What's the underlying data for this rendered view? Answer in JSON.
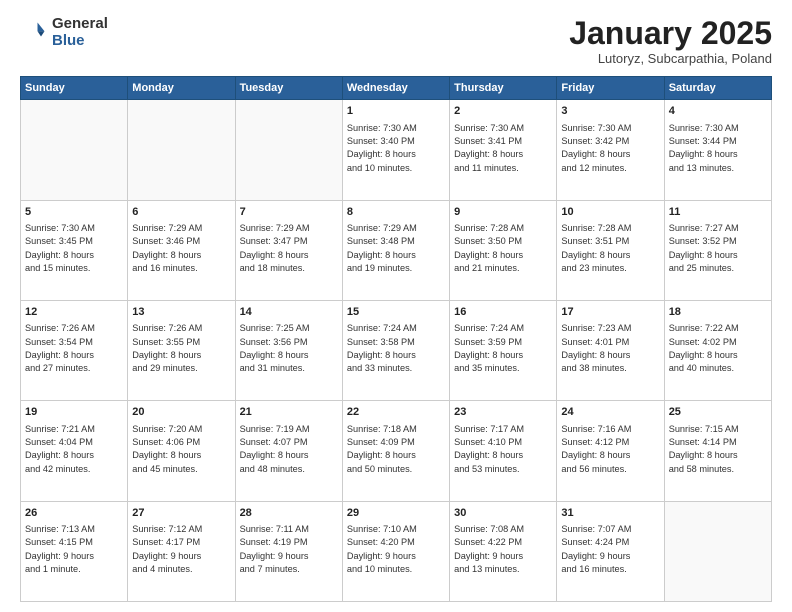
{
  "header": {
    "logo_general": "General",
    "logo_blue": "Blue",
    "month": "January 2025",
    "location": "Lutoryz, Subcarpathia, Poland"
  },
  "weekdays": [
    "Sunday",
    "Monday",
    "Tuesday",
    "Wednesday",
    "Thursday",
    "Friday",
    "Saturday"
  ],
  "weeks": [
    [
      {
        "day": "",
        "info": ""
      },
      {
        "day": "",
        "info": ""
      },
      {
        "day": "",
        "info": ""
      },
      {
        "day": "1",
        "info": "Sunrise: 7:30 AM\nSunset: 3:40 PM\nDaylight: 8 hours\nand 10 minutes."
      },
      {
        "day": "2",
        "info": "Sunrise: 7:30 AM\nSunset: 3:41 PM\nDaylight: 8 hours\nand 11 minutes."
      },
      {
        "day": "3",
        "info": "Sunrise: 7:30 AM\nSunset: 3:42 PM\nDaylight: 8 hours\nand 12 minutes."
      },
      {
        "day": "4",
        "info": "Sunrise: 7:30 AM\nSunset: 3:44 PM\nDaylight: 8 hours\nand 13 minutes."
      }
    ],
    [
      {
        "day": "5",
        "info": "Sunrise: 7:30 AM\nSunset: 3:45 PM\nDaylight: 8 hours\nand 15 minutes."
      },
      {
        "day": "6",
        "info": "Sunrise: 7:29 AM\nSunset: 3:46 PM\nDaylight: 8 hours\nand 16 minutes."
      },
      {
        "day": "7",
        "info": "Sunrise: 7:29 AM\nSunset: 3:47 PM\nDaylight: 8 hours\nand 18 minutes."
      },
      {
        "day": "8",
        "info": "Sunrise: 7:29 AM\nSunset: 3:48 PM\nDaylight: 8 hours\nand 19 minutes."
      },
      {
        "day": "9",
        "info": "Sunrise: 7:28 AM\nSunset: 3:50 PM\nDaylight: 8 hours\nand 21 minutes."
      },
      {
        "day": "10",
        "info": "Sunrise: 7:28 AM\nSunset: 3:51 PM\nDaylight: 8 hours\nand 23 minutes."
      },
      {
        "day": "11",
        "info": "Sunrise: 7:27 AM\nSunset: 3:52 PM\nDaylight: 8 hours\nand 25 minutes."
      }
    ],
    [
      {
        "day": "12",
        "info": "Sunrise: 7:26 AM\nSunset: 3:54 PM\nDaylight: 8 hours\nand 27 minutes."
      },
      {
        "day": "13",
        "info": "Sunrise: 7:26 AM\nSunset: 3:55 PM\nDaylight: 8 hours\nand 29 minutes."
      },
      {
        "day": "14",
        "info": "Sunrise: 7:25 AM\nSunset: 3:56 PM\nDaylight: 8 hours\nand 31 minutes."
      },
      {
        "day": "15",
        "info": "Sunrise: 7:24 AM\nSunset: 3:58 PM\nDaylight: 8 hours\nand 33 minutes."
      },
      {
        "day": "16",
        "info": "Sunrise: 7:24 AM\nSunset: 3:59 PM\nDaylight: 8 hours\nand 35 minutes."
      },
      {
        "day": "17",
        "info": "Sunrise: 7:23 AM\nSunset: 4:01 PM\nDaylight: 8 hours\nand 38 minutes."
      },
      {
        "day": "18",
        "info": "Sunrise: 7:22 AM\nSunset: 4:02 PM\nDaylight: 8 hours\nand 40 minutes."
      }
    ],
    [
      {
        "day": "19",
        "info": "Sunrise: 7:21 AM\nSunset: 4:04 PM\nDaylight: 8 hours\nand 42 minutes."
      },
      {
        "day": "20",
        "info": "Sunrise: 7:20 AM\nSunset: 4:06 PM\nDaylight: 8 hours\nand 45 minutes."
      },
      {
        "day": "21",
        "info": "Sunrise: 7:19 AM\nSunset: 4:07 PM\nDaylight: 8 hours\nand 48 minutes."
      },
      {
        "day": "22",
        "info": "Sunrise: 7:18 AM\nSunset: 4:09 PM\nDaylight: 8 hours\nand 50 minutes."
      },
      {
        "day": "23",
        "info": "Sunrise: 7:17 AM\nSunset: 4:10 PM\nDaylight: 8 hours\nand 53 minutes."
      },
      {
        "day": "24",
        "info": "Sunrise: 7:16 AM\nSunset: 4:12 PM\nDaylight: 8 hours\nand 56 minutes."
      },
      {
        "day": "25",
        "info": "Sunrise: 7:15 AM\nSunset: 4:14 PM\nDaylight: 8 hours\nand 58 minutes."
      }
    ],
    [
      {
        "day": "26",
        "info": "Sunrise: 7:13 AM\nSunset: 4:15 PM\nDaylight: 9 hours\nand 1 minute."
      },
      {
        "day": "27",
        "info": "Sunrise: 7:12 AM\nSunset: 4:17 PM\nDaylight: 9 hours\nand 4 minutes."
      },
      {
        "day": "28",
        "info": "Sunrise: 7:11 AM\nSunset: 4:19 PM\nDaylight: 9 hours\nand 7 minutes."
      },
      {
        "day": "29",
        "info": "Sunrise: 7:10 AM\nSunset: 4:20 PM\nDaylight: 9 hours\nand 10 minutes."
      },
      {
        "day": "30",
        "info": "Sunrise: 7:08 AM\nSunset: 4:22 PM\nDaylight: 9 hours\nand 13 minutes."
      },
      {
        "day": "31",
        "info": "Sunrise: 7:07 AM\nSunset: 4:24 PM\nDaylight: 9 hours\nand 16 minutes."
      },
      {
        "day": "",
        "info": ""
      }
    ]
  ]
}
